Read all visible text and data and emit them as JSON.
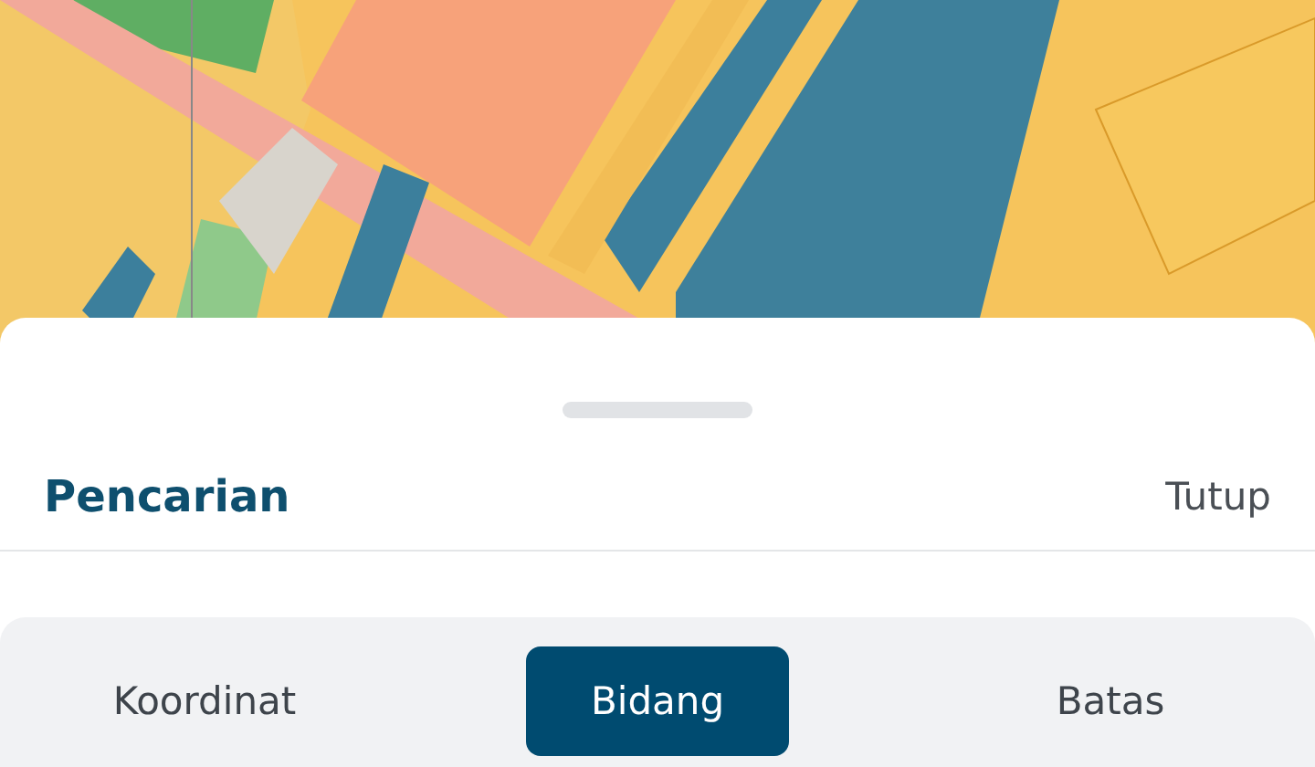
{
  "sheet": {
    "title": "Pencarian",
    "close_label": "Tutup"
  },
  "tabs": [
    {
      "label": "Koordinat",
      "selected": false
    },
    {
      "label": "Bidang",
      "selected": true
    },
    {
      "label": "Batas",
      "selected": false
    }
  ]
}
